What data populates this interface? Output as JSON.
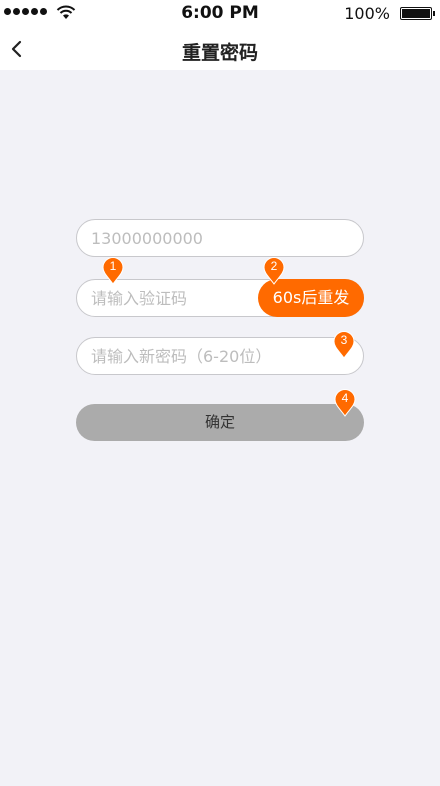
{
  "status_bar": {
    "time": "6:00 PM",
    "battery": "100%",
    "signal_icon": "signal-dots-icon",
    "wifi_icon": "wifi-icon",
    "battery_icon": "battery-icon"
  },
  "nav": {
    "title": "重置密码",
    "back_icon": "chevron-left-icon"
  },
  "form": {
    "phone_value": "13000000000",
    "code_placeholder": "请输入验证码",
    "resend_label": "60s后重发",
    "password_placeholder": "请输入新密码（6-20位）",
    "confirm_label": "确定"
  },
  "markers": [
    "1",
    "2",
    "3",
    "4"
  ],
  "colors": {
    "accent": "#FF6A00",
    "background": "#F2F2F7",
    "confirm_disabled": "#ABABAB"
  }
}
